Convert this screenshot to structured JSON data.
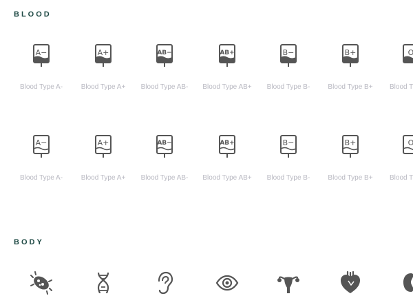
{
  "sections": {
    "blood": {
      "title": "BLOOD"
    },
    "body": {
      "title": "BODY"
    }
  },
  "blood": {
    "row1": [
      {
        "label": "Blood Type A-",
        "glyph": "A−",
        "icon": "blood-bag-a-neg-solid-icon"
      },
      {
        "label": "Blood Type A+",
        "glyph": "A+",
        "icon": "blood-bag-a-pos-solid-icon"
      },
      {
        "label": "Blood Type AB-",
        "glyph": "AB−",
        "icon": "blood-bag-ab-neg-solid-icon"
      },
      {
        "label": "Blood Type AB+",
        "glyph": "AB+",
        "icon": "blood-bag-ab-pos-solid-icon"
      },
      {
        "label": "Blood Type B-",
        "glyph": "B−",
        "icon": "blood-bag-b-neg-solid-icon"
      },
      {
        "label": "Blood Type B+",
        "glyph": "B+",
        "icon": "blood-bag-b-pos-solid-icon"
      },
      {
        "label": "Blood T",
        "glyph": "O",
        "icon": "blood-bag-o-solid-icon"
      }
    ],
    "row2": [
      {
        "label": "Blood Type A-",
        "glyph": "A−",
        "icon": "blood-bag-a-neg-outline-icon"
      },
      {
        "label": "Blood Type A+",
        "glyph": "A+",
        "icon": "blood-bag-a-pos-outline-icon"
      },
      {
        "label": "Blood Type AB-",
        "glyph": "AB−",
        "icon": "blood-bag-ab-neg-outline-icon"
      },
      {
        "label": "Blood Type AB+",
        "glyph": "AB+",
        "icon": "blood-bag-ab-pos-outline-icon"
      },
      {
        "label": "Blood Type B-",
        "glyph": "B−",
        "icon": "blood-bag-b-neg-outline-icon"
      },
      {
        "label": "Blood Type B+",
        "glyph": "B+",
        "icon": "blood-bag-b-pos-outline-icon"
      },
      {
        "label": "Blood T",
        "glyph": "O",
        "icon": "blood-bag-o-outline-icon"
      }
    ]
  },
  "body_icons": [
    "bacteria-icon",
    "dna-icon",
    "ear-icon",
    "eye-icon",
    "uterus-icon",
    "heart-icon",
    "kidney-icon"
  ],
  "colors": {
    "icon": "#555555",
    "label": "#b9b9c2",
    "title": "#1f4a45"
  }
}
